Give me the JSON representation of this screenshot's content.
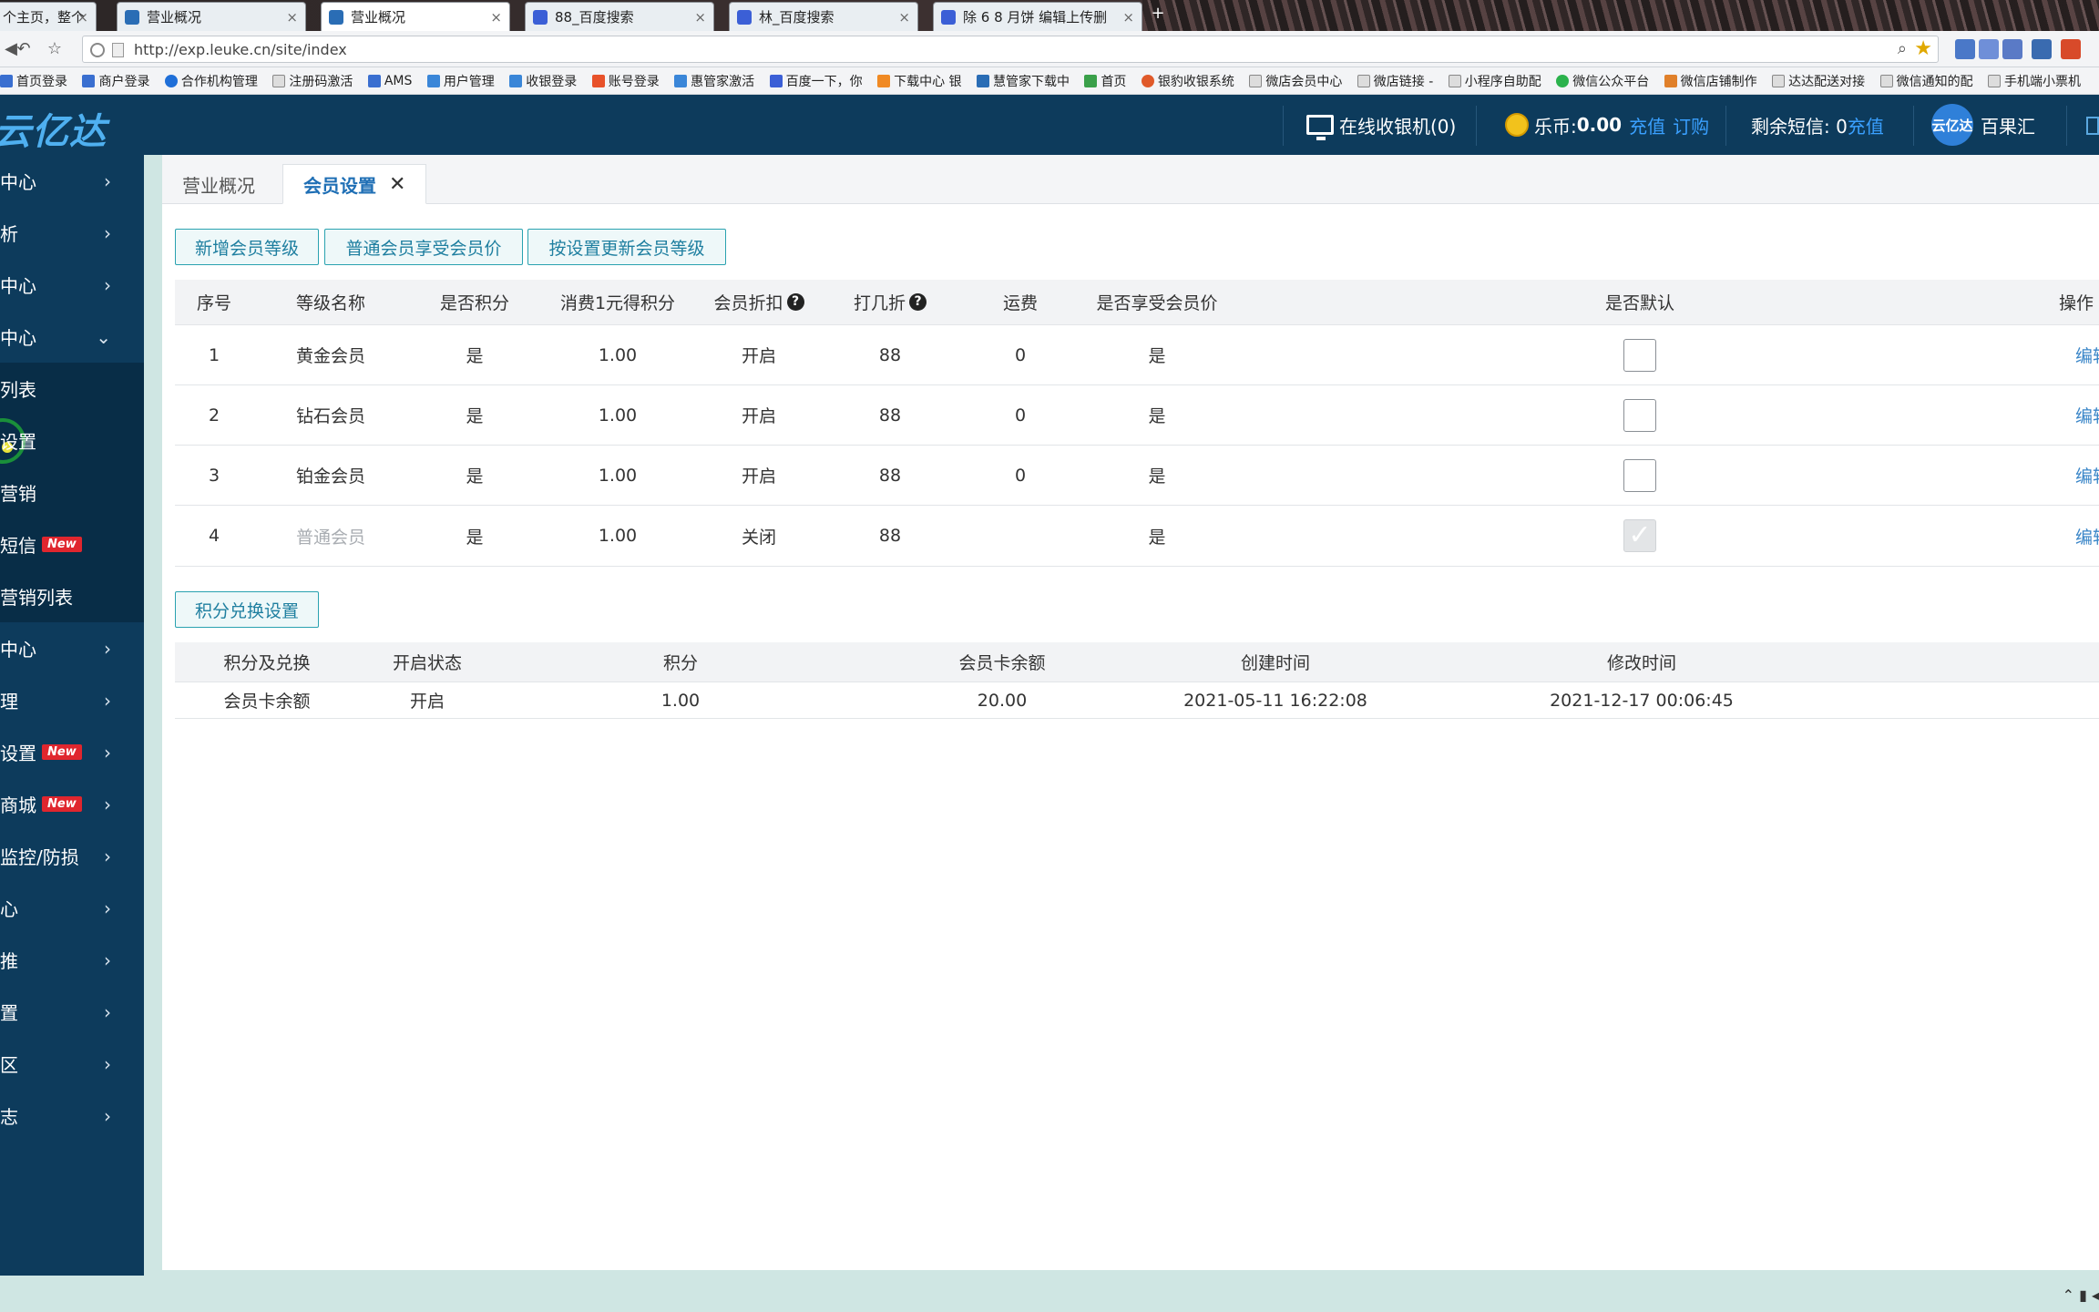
{
  "browser": {
    "tabs": [
      {
        "title": "个主页，整个"
      },
      {
        "title": "营业概况"
      },
      {
        "title": "营业概况"
      },
      {
        "title": "88_百度搜索"
      },
      {
        "title": "林_百度搜索"
      },
      {
        "title": "除 6 8 月饼 编辑上传删"
      }
    ],
    "new_tab": "+",
    "url": "http://exp.leuke.cn/site/index",
    "bookmarks": [
      "首页登录",
      "商户登录",
      "合作机构管理",
      "注册码激活",
      "AMS",
      "用户管理",
      "收银登录",
      "账号登录",
      "惠管家激活",
      "百度一下，你",
      "下载中心 银",
      "慧管家下载中",
      "首页",
      "银豹收银系统",
      "微店会员中心",
      "微店链接 - ",
      "小程序自助配",
      "微信公众平台",
      "微信店铺制作",
      "达达配送对接",
      "微信通知的配",
      "手机端小票机"
    ]
  },
  "header": {
    "logo": "云亿达",
    "cashier": "在线收银机(0)",
    "coin_label": "乐币:",
    "coin_value": "0.00",
    "recharge": "充值",
    "order": "订购",
    "sms_label": "剩余短信: 0",
    "sms_recharge": "充值",
    "avatar_text": "云亿达",
    "user": "百果汇"
  },
  "sidebar": {
    "items": [
      {
        "label": "中心",
        "chevron": "›"
      },
      {
        "label": "析",
        "chevron": "›"
      },
      {
        "label": "中心",
        "chevron": "›"
      },
      {
        "label": "中心",
        "chevron": "⌄"
      },
      {
        "label": "列表"
      },
      {
        "label": "设置"
      },
      {
        "label": "营销"
      },
      {
        "label": "短信",
        "badge": "New"
      },
      {
        "label": "营销列表"
      },
      {
        "label": "中心",
        "chevron": "›"
      },
      {
        "label": "理",
        "chevron": "›"
      },
      {
        "label": "设置",
        "badge": "New",
        "chevron": "›"
      },
      {
        "label": "商城",
        "badge": "New",
        "chevron": "›"
      },
      {
        "label": "监控/防损",
        "chevron": "›"
      },
      {
        "label": "心",
        "chevron": "›"
      },
      {
        "label": "推",
        "chevron": "›"
      },
      {
        "label": "置",
        "chevron": "›"
      },
      {
        "label": "区",
        "chevron": "›"
      },
      {
        "label": "志",
        "chevron": "›"
      }
    ]
  },
  "page_tabs": [
    {
      "label": "营业概况"
    },
    {
      "label": "会员设置",
      "close": "✕"
    }
  ],
  "buttons": {
    "add_level": "新增会员等级",
    "normal_member_price": "普通会员享受会员价",
    "update_level": "按设置更新会员等级",
    "points_exchange": "积分兑换设置"
  },
  "level_table": {
    "headers": [
      "序号",
      "等级名称",
      "是否积分",
      "消费1元得积分",
      "会员折扣",
      "打几折",
      "运费",
      "是否享受会员价",
      "是否默认",
      "操作"
    ],
    "help_icon": "?",
    "rows": [
      {
        "no": "1",
        "name": "黄金会员",
        "points": "是",
        "per_yuan": "1.00",
        "discount": "开启",
        "rate": "88",
        "freight": "0",
        "member_price": "是",
        "default": false,
        "op": "编辑"
      },
      {
        "no": "2",
        "name": "钻石会员",
        "points": "是",
        "per_yuan": "1.00",
        "discount": "开启",
        "rate": "88",
        "freight": "0",
        "member_price": "是",
        "default": false,
        "op": "编辑"
      },
      {
        "no": "3",
        "name": "铂金会员",
        "points": "是",
        "per_yuan": "1.00",
        "discount": "开启",
        "rate": "88",
        "freight": "0",
        "member_price": "是",
        "default": false,
        "op": "编辑"
      },
      {
        "no": "4",
        "name": "普通会员",
        "points": "是",
        "per_yuan": "1.00",
        "discount": "关闭",
        "rate": "88",
        "freight": "",
        "member_price": "是",
        "default": true,
        "op": "编辑"
      }
    ]
  },
  "points_table": {
    "headers": [
      "积分及兑换",
      "开启状态",
      "积分",
      "会员卡余额",
      "创建时间",
      "修改时间"
    ],
    "rows": [
      {
        "type": "会员卡余额",
        "status": "开启",
        "points": "1.00",
        "balance": "20.00",
        "created": "2021-05-11 16:22:08",
        "modified": "2021-12-17 00:06:45"
      }
    ]
  },
  "colors": {
    "header_bg": "#0d3b5c",
    "accent": "#1f6fb5",
    "button_border": "#2aa2b0",
    "new_badge": "#e0262e"
  }
}
